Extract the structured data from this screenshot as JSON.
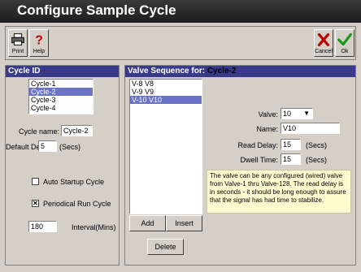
{
  "window": {
    "title": "Configure Sample Cycle"
  },
  "toolbar": {
    "print_label": "Print",
    "help_label": "Help",
    "cancel_label": "Cancel",
    "ok_label": "Ok"
  },
  "cycle_panel": {
    "header": "Cycle ID",
    "cycles": [
      "Cycle-1",
      "Cycle-2",
      "Cycle-3",
      "Cycle-4"
    ],
    "selected_index": 1,
    "cycle_name_label": "Cycle name:",
    "cycle_name_value": "Cycle-2",
    "default_delay_label": "Default Delay:",
    "default_delay_value": "5",
    "default_delay_unit": "(Secs)",
    "auto_startup_label": "Auto Startup Cycle",
    "auto_startup_checked": false,
    "periodical_label": "Periodical Run Cycle",
    "periodical_checked": true,
    "interval_value": "180",
    "interval_label": "Interval(Mins)"
  },
  "valve_panel": {
    "header_prefix": "Valve Sequence for:",
    "header_cycle": "Cycle-2",
    "sequence": [
      "V-8 V8",
      "V-9 V9",
      "V-10 V10"
    ],
    "selected_index": 2,
    "valve_label": "Valve:",
    "valve_value": "10",
    "name_label": "Name:",
    "name_value": "V10",
    "read_delay_label": "Read Delay:",
    "read_delay_value": "15",
    "read_delay_unit": "(Secs)",
    "dwell_time_label": "Dwell Time:",
    "dwell_time_value": "15",
    "dwell_time_unit": "(Secs)",
    "note": "The valve can be any configured (wired) valve from Valve-1 thru Valve-128. The read delay is in seconds - it should be long enough to assure that the signal has had time to stabilize.",
    "add_label": "Add",
    "insert_label": "Insert",
    "delete_label": "Delete"
  }
}
